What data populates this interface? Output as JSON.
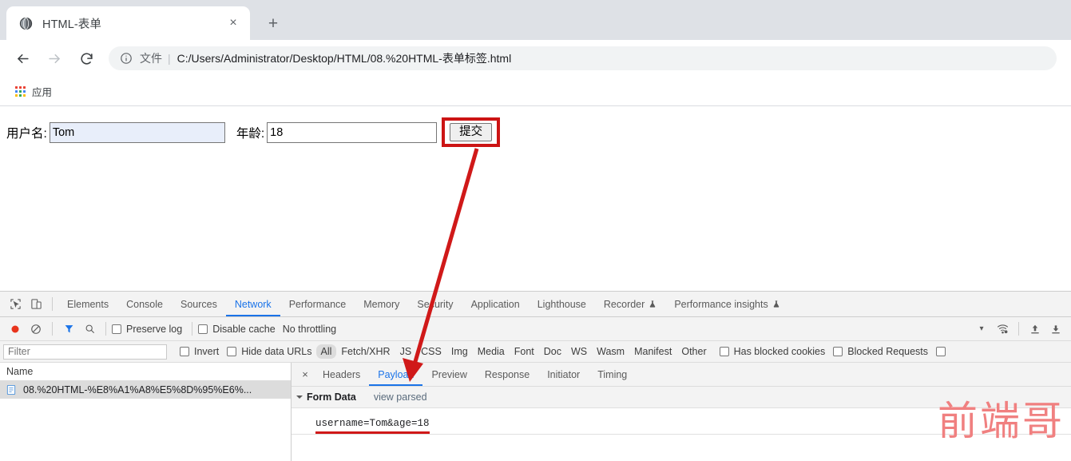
{
  "browser": {
    "tab": {
      "title": "HTML-表单",
      "favicon": "globe-icon",
      "close": "×"
    },
    "new_tab": "+",
    "nav": {
      "back": "←",
      "forward": "→",
      "reload": "⟳"
    },
    "omnibox": {
      "info_icon": "info-circle-icon",
      "scheme_label": "文件",
      "separator": "|",
      "url": "C:/Users/Administrator/Desktop/HTML/08.%20HTML-表单标签.html"
    },
    "bookmarks": {
      "apps_label": "应用",
      "apps_icon": "apps-grid-icon"
    }
  },
  "page": {
    "username_label": "用户名:",
    "username_value": "Tom",
    "age_label": "年龄:",
    "age_value": "18",
    "submit_label": "提交",
    "highlight_color": "#cc1414",
    "autofill_color": "#e8eefa"
  },
  "devtools": {
    "inspect_icon": "inspect-cursor-icon",
    "device_icon": "device-toggle-icon",
    "tabs": [
      {
        "label": "Elements",
        "active": false,
        "flask": false
      },
      {
        "label": "Console",
        "active": false,
        "flask": false
      },
      {
        "label": "Sources",
        "active": false,
        "flask": false
      },
      {
        "label": "Network",
        "active": true,
        "flask": false
      },
      {
        "label": "Performance",
        "active": false,
        "flask": false
      },
      {
        "label": "Memory",
        "active": false,
        "flask": false
      },
      {
        "label": "Security",
        "active": false,
        "flask": false
      },
      {
        "label": "Application",
        "active": false,
        "flask": false
      },
      {
        "label": "Lighthouse",
        "active": false,
        "flask": false
      },
      {
        "label": "Recorder",
        "active": false,
        "flask": true
      },
      {
        "label": "Performance insights",
        "active": false,
        "flask": true
      }
    ],
    "toolbar": {
      "record_icon": "record-dot-icon",
      "clear_icon": "clear-circle-slash-icon",
      "filter_icon": "funnel-filter-icon",
      "search_icon": "search-magnifier-icon",
      "preserve_log": "Preserve log",
      "disable_cache": "Disable cache",
      "throttling": "No throttling",
      "throttling_caret": "▾",
      "wifi_icon": "wifi-settings-icon",
      "import_icon": "upload-arrow-icon",
      "export_icon": "download-arrow-icon"
    },
    "filterbar": {
      "filter_placeholder": "Filter",
      "filter_value": "",
      "invert": "Invert",
      "hide_data_urls": "Hide data URLs",
      "types": [
        "All",
        "Fetch/XHR",
        "JS",
        "CSS",
        "Img",
        "Media",
        "Font",
        "Doc",
        "WS",
        "Wasm",
        "Manifest",
        "Other"
      ],
      "selected_type": "All",
      "has_blocked_cookies": "Has blocked cookies",
      "blocked_requests": "Blocked Requests"
    },
    "requests": {
      "column_name": "Name",
      "rows": [
        {
          "icon": "document-file-icon",
          "name": "08.%20HTML-%E8%A1%A8%E5%8D%95%E6%..."
        }
      ]
    },
    "details": {
      "close": "×",
      "tabs": [
        {
          "label": "Headers",
          "active": false
        },
        {
          "label": "Payload",
          "active": true
        },
        {
          "label": "Preview",
          "active": false
        },
        {
          "label": "Response",
          "active": false
        },
        {
          "label": "Initiator",
          "active": false
        },
        {
          "label": "Timing",
          "active": false
        }
      ],
      "form_data_title": "Form Data",
      "view_parsed": "view parsed",
      "form_data_value": "username=Tom&age=18",
      "underline_color": "#d01919"
    }
  },
  "watermark": {
    "text": "前端哥",
    "color": "#f08080"
  }
}
